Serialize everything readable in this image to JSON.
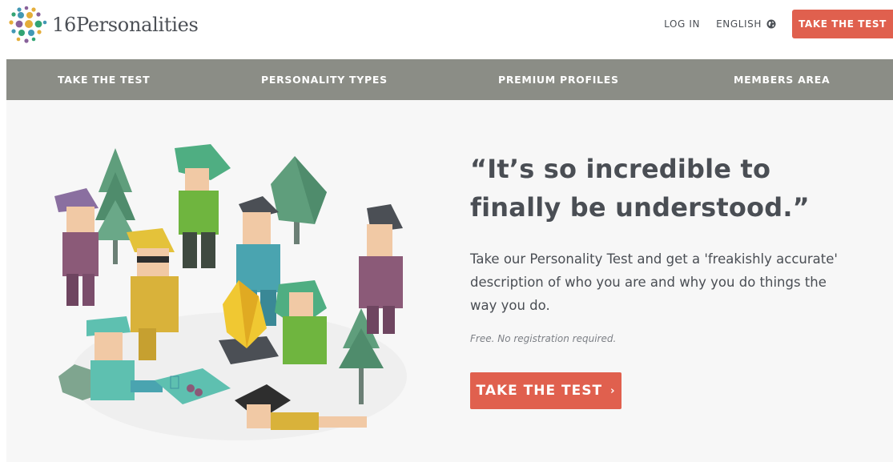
{
  "header": {
    "logo_text": "16Personalities",
    "login_label": "LOG IN",
    "language_label": "ENGLISH",
    "cta_label": "TAKE THE TEST"
  },
  "nav": {
    "items": [
      {
        "label": "TAKE THE TEST"
      },
      {
        "label": "PERSONALITY TYPES"
      },
      {
        "label": "PREMIUM PROFILES"
      },
      {
        "label": "MEMBERS AREA"
      }
    ]
  },
  "hero": {
    "quote": "“It’s so incredible to finally be understood.”",
    "description": "Take our Personality Test and get a 'freakishly accurate' description of who you are and why you do things the way you do.",
    "note": "Free. No registration required.",
    "cta_label": "TAKE THE TEST",
    "cta_chevron": "›"
  },
  "colors": {
    "accent": "#e0604e",
    "navbar": "#8b8d86",
    "hero_bg": "#f7f7f7",
    "text": "#4a4e54"
  },
  "icons": {
    "logo": "dots-logo-icon",
    "language": "globe-icon",
    "cta": "chevron-right-icon"
  }
}
